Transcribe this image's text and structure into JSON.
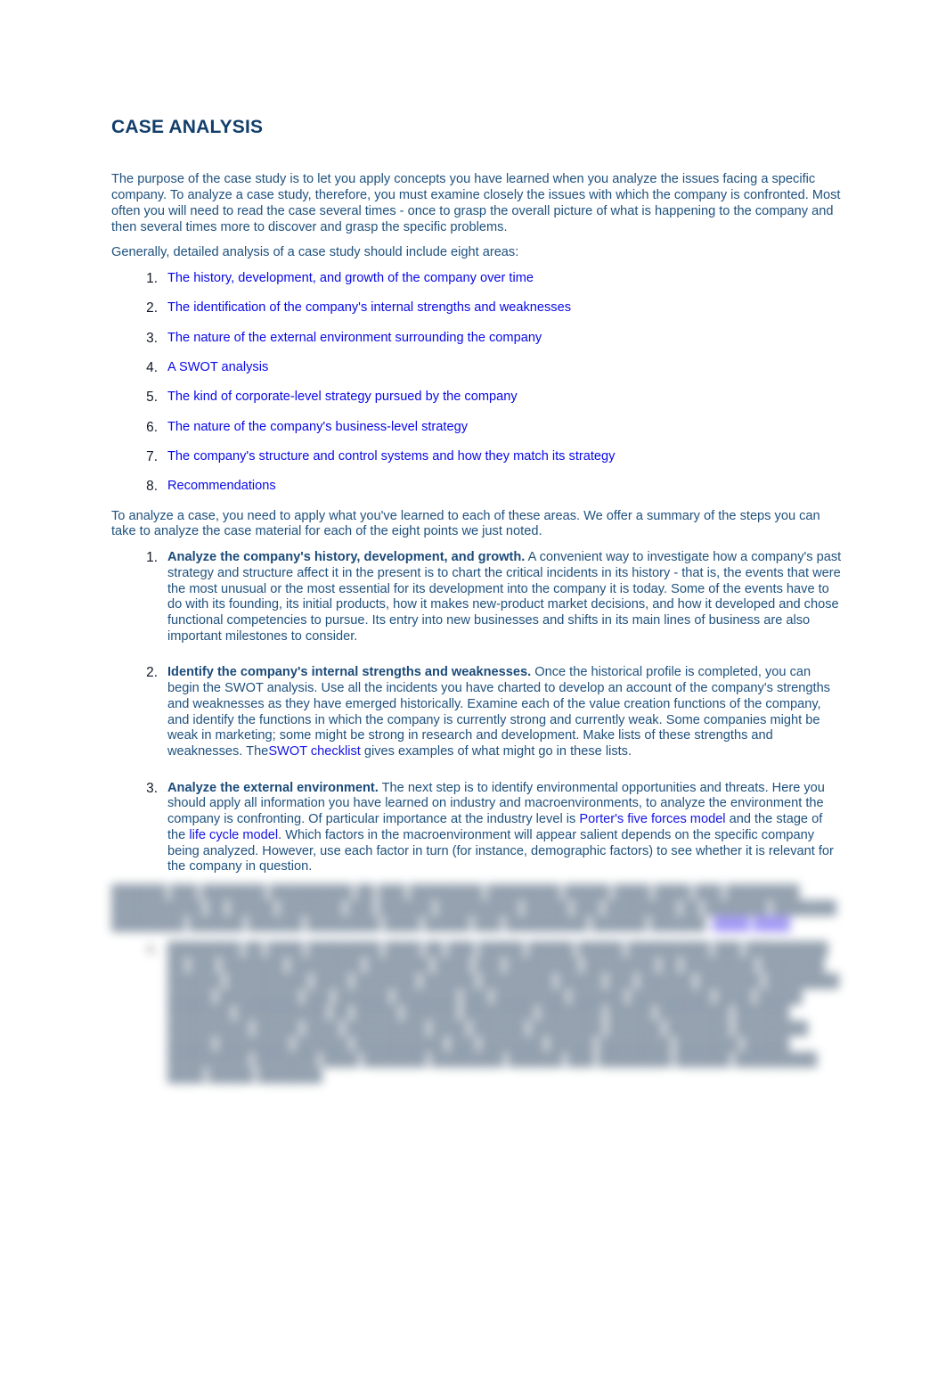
{
  "document": {
    "title": "CASE ANALYSIS",
    "intro_paragraph": "The purpose of the case study is to let you apply concepts you have learned when you analyze the issues facing a specific company. To analyze a case study, therefore, you must examine closely the issues with which the company is confronted. Most often you will need to read the case several times - once to grasp the overall picture of what is happening to the company and then several times more to discover and grasp the specific problems.",
    "list_lead_in": "Generally, detailed analysis of a case study should include eight areas:",
    "areas": [
      {
        "number": "1.",
        "label": "The history, development, and growth of the company over time"
      },
      {
        "number": "2.",
        "label": "The identification of the company's internal strengths and weaknesses"
      },
      {
        "number": "3.",
        "label": "The nature of the external environment surrounding the company"
      },
      {
        "number": "4.",
        "label": "A SWOT analysis"
      },
      {
        "number": "5.",
        "label": "The kind of corporate-level strategy pursued by the company"
      },
      {
        "number": "6.",
        "label": "The nature of the company's business-level strategy"
      },
      {
        "number": "7.",
        "label": "The company's structure and control systems and how they match its strategy"
      },
      {
        "number": "8.",
        "label": "Recommendations"
      }
    ],
    "steps_lead_in": "To analyze a case, you need to apply what you've learned to each of these areas. We offer a summary of the steps you can take to analyze the case material for each of the eight points we just noted.",
    "steps": [
      {
        "number": "1.",
        "lead": "Analyze the company's history, development, and growth.",
        "body": " A convenient way to investigate how a company's past strategy and structure affect it in the present is to chart the critical incidents in its history - that is, the events that were the most unusual or the most essential for its development into the company it is today. Some of the events have to do with its founding, its initial products, how it makes new-product market decisions, and how it developed and chose functional competencies to pursue. Its entry into new businesses and shifts in its main lines of business are also important milestones to consider."
      },
      {
        "number": "2.",
        "lead": "Identify the company's internal strengths and weaknesses.",
        "body_before": " Once the historical profile is completed, you can begin the SWOT analysis. Use all the incidents you have charted to develop an account of the company's strengths and weaknesses as they have emerged historically. Examine each of the value creation functions of the company, and identify the functions in which the company is currently strong and currently weak. Some companies might be weak in marketing; some might be strong in research and development. Make lists of these strengths and weaknesses. The",
        "link_1": "SWOT checklist",
        "body_after": " gives examples of what might go in these lists."
      },
      {
        "number": "3.",
        "lead": "Analyze the external environment.",
        "body_before": " The next step is to identify environmental opportunities and threats. Here you should apply all information you have learned on industry and macroenvironments, to analyze the environment the company is confronting. Of particular importance at the industry level is ",
        "link_1": "Porter's five forces model",
        "body_middle": " and the stage of the ",
        "link_2": "life cycle model",
        "body_after": ". Which factors in the macroenvironment will appear salient depends on the specific company being analyzed. However, use each factor in turn (for instance, demographic factors) to see whether it is relevant for the company in question."
      }
    ],
    "obscured_region": {
      "note": "blurred-unreadable",
      "paragraph": "██████ ███ ███████ █████████ ██ ███ ████████ ████████ █████ ████ ████ ███ ████████ ██████████ ██ █████ ███████ ███ ██████ █████████ █████ ███ ████████ ██ ███████ ███████ ████████ ██████ ██████ ████████ ████ █████ ███ █████████ ██████ ██████.",
      "link_label": "████ ████",
      "step": {
        "number": "4.",
        "body": "████████ ██ ████ ████████ ████ ██ ███ █████ █████ █████ █████████ ███ █████████ ██ ███ ███████ ████████ ███████ ████ ███ ████████ ████████ ██ ████████ ███████ ██████ █████████ ████ ███████ ██████ ████████ █████ ███ ██████ ███████ ████████ █████ █████████ ███ ██████ ███████ ███ ████████ ██████ █████████ ████ █████ ███████ ██████████ ██ █████ ██████ ████████ ███████ █████ ████████ ██████ █████████ █████ ████ █████████ ████ ██████ ████████ ██████ ███████ ████████ █████ ████████ ██████ ██████████ ███ ███████ █████ ████████ ███████ █████ █████████ ███████ ████ ███████ ████████ ██████ ███ ████████ ██████ █████████ ████ █████ ███████."
      }
    }
  }
}
